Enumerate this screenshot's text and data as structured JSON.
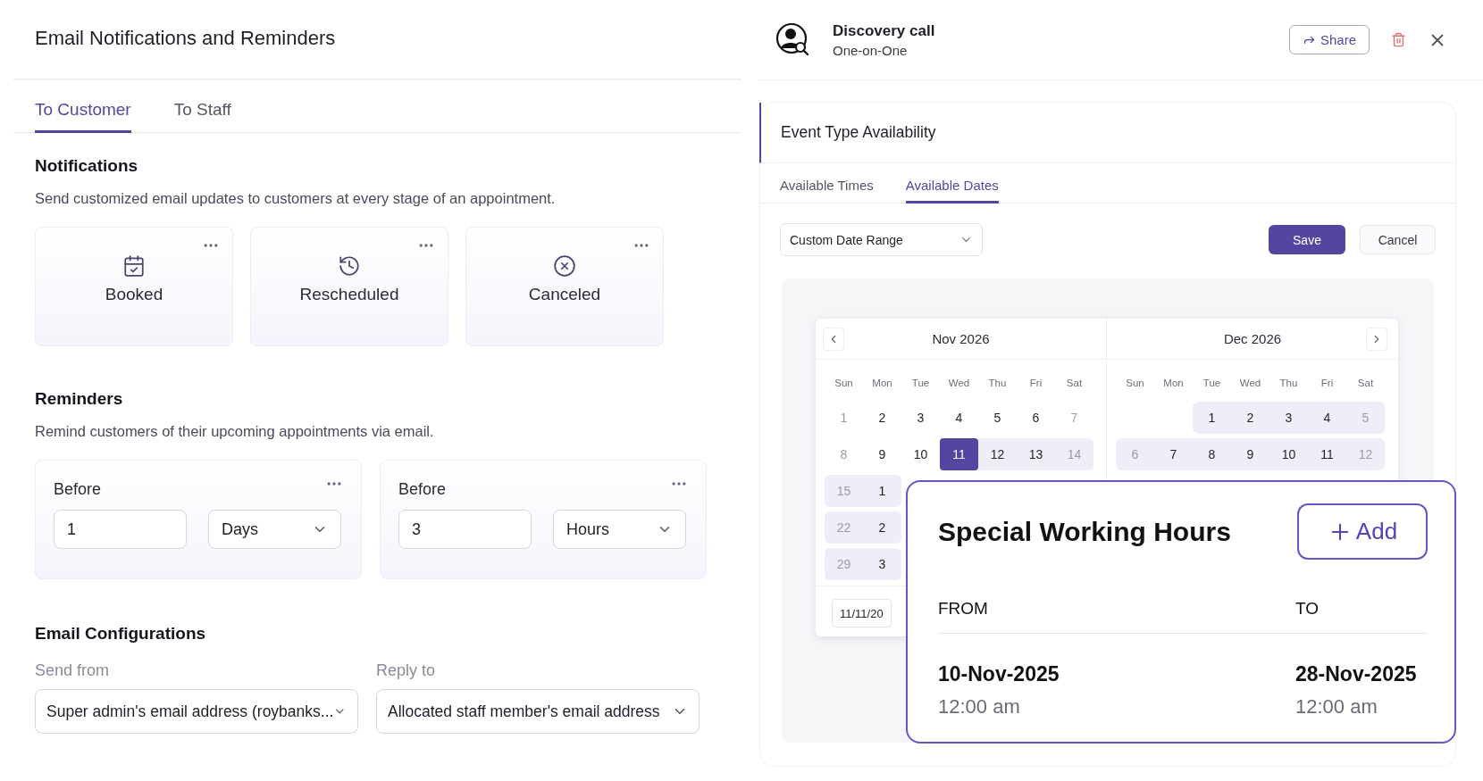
{
  "left": {
    "title": "Email Notifications and Reminders",
    "tabs": [
      {
        "label": "To Customer",
        "selected": true
      },
      {
        "label": "To Staff",
        "selected": false
      }
    ],
    "notifications": {
      "heading": "Notifications",
      "description": "Send customized email updates to customers at every stage of an appointment.",
      "cards": [
        {
          "kind": "booked",
          "label": "Booked"
        },
        {
          "kind": "rescheduled",
          "label": "Rescheduled"
        },
        {
          "kind": "canceled",
          "label": "Canceled"
        }
      ]
    },
    "reminders": {
      "heading": "Reminders",
      "description": "Remind customers of their upcoming appointments via email.",
      "cards": [
        {
          "label": "Before",
          "value": "1",
          "unit": "Days"
        },
        {
          "label": "Before",
          "value": "3",
          "unit": "Hours"
        }
      ]
    },
    "email_configurations": {
      "heading": "Email Configurations",
      "fields": [
        {
          "label": "Send from",
          "value": "Super admin's email address (roybanks..."
        },
        {
          "label": "Reply to",
          "value": "Allocated staff member's email address"
        }
      ]
    }
  },
  "right": {
    "header": {
      "title": "Discovery call",
      "subtitle": "One-on-One",
      "share": "Share"
    },
    "availability": {
      "title": "Event Type Availability",
      "tabs": [
        {
          "label": "Available Times",
          "selected": false
        },
        {
          "label": "Available Dates",
          "selected": true
        }
      ],
      "range_select": "Custom Date Range",
      "save": "Save",
      "cancel": "Cancel",
      "calendar": {
        "months": [
          {
            "title": "Nov 2026",
            "weekdays": [
              "Sun",
              "Mon",
              "Tue",
              "Wed",
              "Thu",
              "Fri",
              "Sat"
            ],
            "weeks": [
              [
                {
                  "kind": "day",
                  "label": "1",
                  "muted": true,
                  "in_range": false,
                  "selected": false
                },
                {
                  "kind": "day",
                  "label": "2",
                  "muted": false,
                  "in_range": false,
                  "selected": false
                },
                {
                  "kind": "day",
                  "label": "3",
                  "muted": false,
                  "in_range": false,
                  "selected": false
                },
                {
                  "kind": "day",
                  "label": "4",
                  "muted": false,
                  "in_range": false,
                  "selected": false
                },
                {
                  "kind": "day",
                  "label": "5",
                  "muted": false,
                  "in_range": false,
                  "selected": false
                },
                {
                  "kind": "day",
                  "label": "6",
                  "muted": false,
                  "in_range": false,
                  "selected": false
                },
                {
                  "kind": "day",
                  "label": "7",
                  "muted": true,
                  "in_range": false,
                  "selected": false
                }
              ],
              [
                {
                  "kind": "day",
                  "label": "8",
                  "muted": true,
                  "in_range": false,
                  "selected": false
                },
                {
                  "kind": "day",
                  "label": "9",
                  "muted": false,
                  "in_range": false,
                  "selected": false
                },
                {
                  "kind": "day",
                  "label": "10",
                  "muted": false,
                  "in_range": false,
                  "selected": false
                },
                {
                  "kind": "day",
                  "label": "11",
                  "muted": false,
                  "in_range": false,
                  "selected": true
                },
                {
                  "kind": "day",
                  "label": "12",
                  "muted": false,
                  "in_range": true,
                  "selected": false
                },
                {
                  "kind": "day",
                  "label": "13",
                  "muted": false,
                  "in_range": true,
                  "selected": false
                },
                {
                  "kind": "day",
                  "label": "14",
                  "muted": true,
                  "in_range": true,
                  "selected": false
                }
              ],
              [
                {
                  "kind": "day",
                  "label": "15",
                  "muted": true,
                  "in_range": true,
                  "selected": false
                },
                {
                  "kind": "day",
                  "label": "1",
                  "muted": false,
                  "in_range": true,
                  "selected": false
                }
              ],
              [
                {
                  "kind": "day",
                  "label": "22",
                  "muted": true,
                  "in_range": true,
                  "selected": false
                },
                {
                  "kind": "day",
                  "label": "2",
                  "muted": false,
                  "in_range": true,
                  "selected": false
                }
              ],
              [
                {
                  "kind": "day",
                  "label": "29",
                  "muted": true,
                  "in_range": true,
                  "selected": false
                },
                {
                  "kind": "day",
                  "label": "3",
                  "muted": false,
                  "in_range": true,
                  "selected": false
                }
              ]
            ]
          },
          {
            "title": "Dec 2026",
            "weekdays": [
              "Sun",
              "Mon",
              "Tue",
              "Wed",
              "Thu",
              "Fri",
              "Sat"
            ],
            "weeks": [
              [
                {
                  "kind": "blank"
                },
                {
                  "kind": "blank"
                },
                {
                  "kind": "day",
                  "label": "1",
                  "muted": false,
                  "in_range": true,
                  "selected": false
                },
                {
                  "kind": "day",
                  "label": "2",
                  "muted": false,
                  "in_range": true,
                  "selected": false
                },
                {
                  "kind": "day",
                  "label": "3",
                  "muted": false,
                  "in_range": true,
                  "selected": false
                },
                {
                  "kind": "day",
                  "label": "4",
                  "muted": false,
                  "in_range": true,
                  "selected": false
                },
                {
                  "kind": "day",
                  "label": "5",
                  "muted": true,
                  "in_range": true,
                  "selected": false
                }
              ],
              [
                {
                  "kind": "day",
                  "label": "6",
                  "muted": true,
                  "in_range": true,
                  "selected": false
                },
                {
                  "kind": "day",
                  "label": "7",
                  "muted": false,
                  "in_range": true,
                  "selected": false
                },
                {
                  "kind": "day",
                  "label": "8",
                  "muted": false,
                  "in_range": true,
                  "selected": false
                },
                {
                  "kind": "day",
                  "label": "9",
                  "muted": false,
                  "in_range": true,
                  "selected": false
                },
                {
                  "kind": "day",
                  "label": "10",
                  "muted": false,
                  "in_range": true,
                  "selected": false
                },
                {
                  "kind": "day",
                  "label": "11",
                  "muted": false,
                  "in_range": true,
                  "selected": false
                },
                {
                  "kind": "day",
                  "label": "12",
                  "muted": true,
                  "in_range": true,
                  "selected": false
                }
              ]
            ]
          }
        ],
        "date_input": "11/11/20"
      }
    },
    "special_hours": {
      "title": "Special Working Hours",
      "add": "Add",
      "columns": [
        "FROM",
        "TO"
      ],
      "rows": [
        {
          "from_date": "10-Nov-2025",
          "from_time": "12:00 am",
          "to_date": "28-Nov-2025",
          "to_time": "12:00 am"
        }
      ]
    }
  }
}
